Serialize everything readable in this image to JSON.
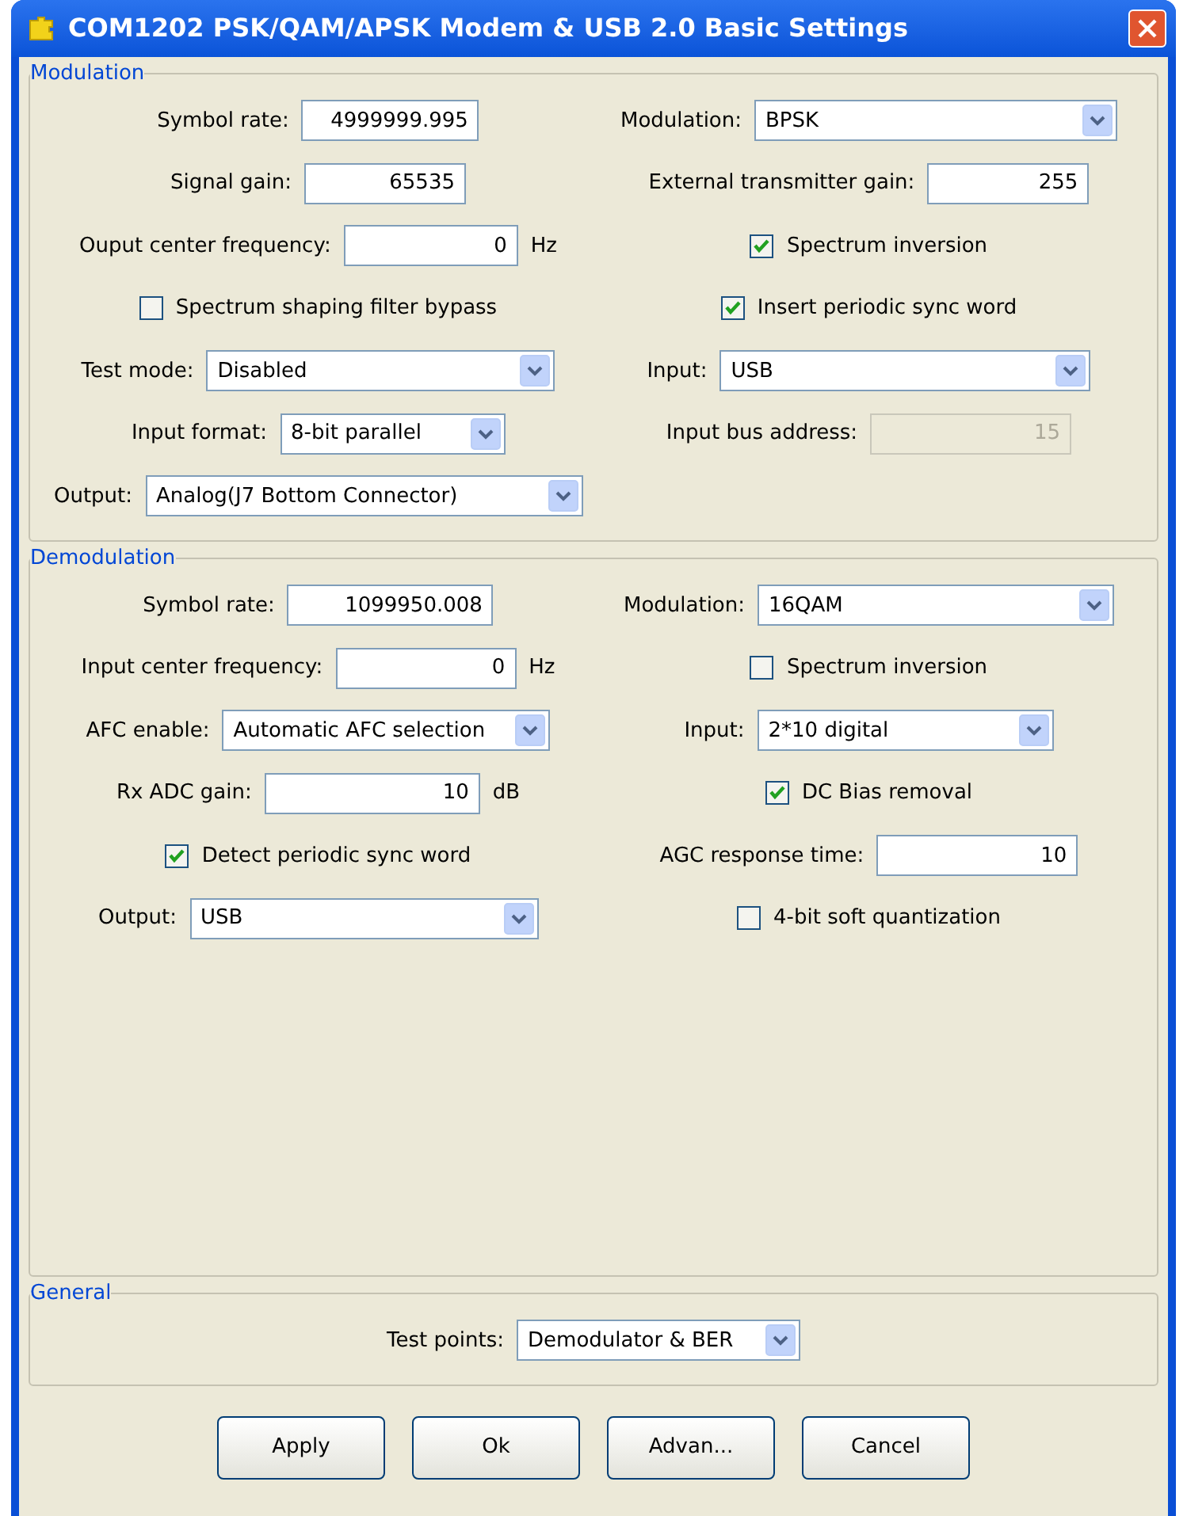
{
  "window": {
    "title": "COM1202 PSK/QAM/APSK Modem & USB 2.0 Basic Settings"
  },
  "sections": [
    {
      "title": "Modulation",
      "rows": [
        [
          {
            "kind": "field",
            "label": "Symbol rate:",
            "value": "4999999.995",
            "disabled": false
          },
          {
            "kind": "dropdown",
            "label": "Modulation:",
            "value": "BPSK"
          }
        ],
        [
          {
            "kind": "field",
            "label": "Signal gain:",
            "value": "65535",
            "disabled": false
          },
          {
            "kind": "field",
            "label": "External transmitter gain:",
            "value": "255",
            "disabled": false
          }
        ],
        [
          {
            "kind": "field",
            "label": "Ouput center frequency:",
            "value": "0",
            "unit": "Hz",
            "disabled": false
          },
          {
            "kind": "checkbox",
            "label": "Spectrum inversion",
            "checked": true
          }
        ],
        [
          {
            "kind": "checkbox",
            "label": "Spectrum shaping filter bypass",
            "checked": false
          },
          {
            "kind": "checkbox",
            "label": "Insert periodic sync word",
            "checked": true
          }
        ],
        [
          {
            "kind": "dropdown",
            "label": "Test mode:",
            "value": "Disabled"
          },
          {
            "kind": "dropdown",
            "label": "Input:",
            "value": "USB"
          }
        ],
        [
          {
            "kind": "dropdown",
            "label": "Input format:",
            "value": "8-bit parallel"
          },
          {
            "kind": "field",
            "label": "Input bus address:",
            "value": "15",
            "disabled": true
          }
        ],
        [
          {
            "kind": "dropdown",
            "label": "Output:",
            "value": "Analog(J7 Bottom Connector)"
          }
        ]
      ]
    },
    {
      "title": "Demodulation",
      "rows": [
        [
          {
            "kind": "field",
            "label": "Symbol rate:",
            "value": "1099950.008",
            "disabled": false
          },
          {
            "kind": "dropdown",
            "label": "Modulation:",
            "value": "16QAM"
          }
        ],
        [
          {
            "kind": "field",
            "label": "Input center frequency:",
            "value": "0",
            "unit": "Hz",
            "disabled": false
          },
          {
            "kind": "checkbox",
            "label": "Spectrum inversion",
            "checked": false
          }
        ],
        [
          {
            "kind": "dropdown",
            "label": "AFC enable:",
            "value": "Automatic AFC selection"
          },
          {
            "kind": "dropdown",
            "label": "Input:",
            "value": "2*10 digital"
          }
        ],
        [
          {
            "kind": "field",
            "label": "Rx ADC gain:",
            "value": "10",
            "unit": "dB",
            "disabled": false
          },
          {
            "kind": "checkbox",
            "label": "DC Bias removal",
            "checked": true
          }
        ],
        [
          {
            "kind": "checkbox",
            "label": "Detect periodic sync word",
            "checked": true
          },
          {
            "kind": "field",
            "label": "AGC response time:",
            "value": "10",
            "disabled": false
          }
        ],
        [
          {
            "kind": "dropdown",
            "label": "Output:",
            "value": "USB"
          },
          {
            "kind": "checkbox",
            "label": "4-bit soft quantization",
            "checked": false
          }
        ]
      ]
    },
    {
      "title": "General",
      "rows": [
        [
          {
            "kind": "dropdown",
            "label": "Test points:",
            "value": "Demodulator & BER"
          }
        ]
      ]
    }
  ],
  "buttons": [
    "Apply",
    "Ok",
    "Advan...",
    "Cancel"
  ]
}
